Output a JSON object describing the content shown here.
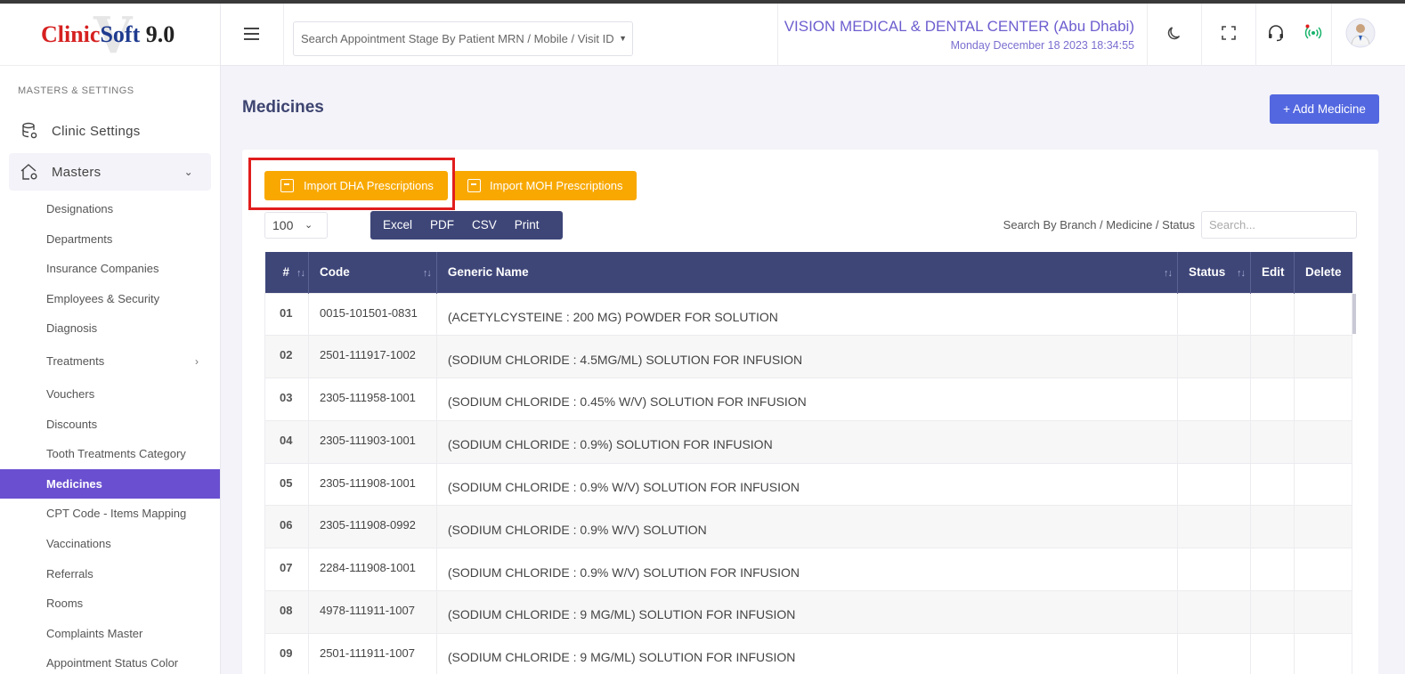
{
  "app": {
    "logo_parts": [
      "Clinic",
      "Soft",
      " 9.0"
    ],
    "logo_watermark": "V"
  },
  "sidebar": {
    "section_label": "MASTERS & SETTINGS",
    "main_items": [
      {
        "label": "Clinic Settings",
        "icon": "database-gear-icon"
      },
      {
        "label": "Masters",
        "icon": "home-gear-icon"
      }
    ],
    "sub_items": [
      {
        "label": "Designations"
      },
      {
        "label": "Departments"
      },
      {
        "label": "Insurance Companies"
      },
      {
        "label": "Employees & Security"
      },
      {
        "label": "Diagnosis"
      },
      {
        "label": "Treatments"
      },
      {
        "label": "Vouchers"
      },
      {
        "label": "Discounts"
      },
      {
        "label": "Tooth Treatments Category"
      },
      {
        "label": "Medicines"
      },
      {
        "label": "CPT Code - Items Mapping"
      },
      {
        "label": "Vaccinations"
      },
      {
        "label": "Referrals"
      },
      {
        "label": "Rooms"
      },
      {
        "label": "Complaints Master"
      },
      {
        "label": "Appointment Status Color"
      }
    ],
    "active_sub_item": "Medicines"
  },
  "header": {
    "search_placeholder": "Search Appointment Stage By Patient MRN / Mobile / Visit ID",
    "clinic_name": "VISION MEDICAL & DENTAL CENTER (Abu Dhabi)",
    "datetime": "Monday December 18 2023 18:34:55",
    "icons": [
      "moon-icon",
      "fullscreen-icon",
      "headset-icon",
      "live-signal-icon",
      "avatar"
    ]
  },
  "main": {
    "title": "Medicines",
    "add_button": "+ Add Medicine",
    "import_dha": "Import DHA Prescriptions",
    "import_moh": "Import MOH Prescriptions",
    "page_size": "100",
    "export_buttons": [
      "Excel",
      "PDF",
      "CSV",
      "Print"
    ],
    "search_label": "Search By Branch / Medicine / Status",
    "search_placeholder": "Search..."
  },
  "table": {
    "headers": [
      "#",
      "Code",
      "Generic Name",
      "Status",
      "Edit",
      "Delete"
    ],
    "rows": [
      {
        "num": "01",
        "code": "0015-101501-0831",
        "name": "(ACETYLCYSTEINE : 200 MG) POWDER FOR SOLUTION"
      },
      {
        "num": "02",
        "code": "2501-111917-1002",
        "name": "(SODIUM CHLORIDE : 4.5MG/ML) SOLUTION FOR INFUSION"
      },
      {
        "num": "03",
        "code": "2305-111958-1001",
        "name": "(SODIUM CHLORIDE : 0.45% W/V) SOLUTION FOR INFUSION"
      },
      {
        "num": "04",
        "code": "2305-111903-1001",
        "name": "(SODIUM CHLORIDE : 0.9%) SOLUTION FOR INFUSION"
      },
      {
        "num": "05",
        "code": "2305-111908-1001",
        "name": "(SODIUM CHLORIDE : 0.9% W/V) SOLUTION FOR INFUSION"
      },
      {
        "num": "06",
        "code": "2305-111908-0992",
        "name": "(SODIUM CHLORIDE : 0.9% W/V) SOLUTION"
      },
      {
        "num": "07",
        "code": "2284-111908-1001",
        "name": "(SODIUM CHLORIDE : 0.9% W/V) SOLUTION FOR INFUSION"
      },
      {
        "num": "08",
        "code": "4978-111911-1007",
        "name": "(SODIUM CHLORIDE : 9 MG/ML) SOLUTION FOR INFUSION"
      },
      {
        "num": "09",
        "code": "2501-111911-1007",
        "name": "(SODIUM CHLORIDE : 9 MG/ML) SOLUTION FOR INFUSION"
      }
    ]
  },
  "colors": {
    "accent": "#6a4fd0",
    "primary_button": "#5367e0",
    "import_button": "#f8a800",
    "table_header": "#3e4678",
    "highlight_box": "#e11d1d"
  }
}
